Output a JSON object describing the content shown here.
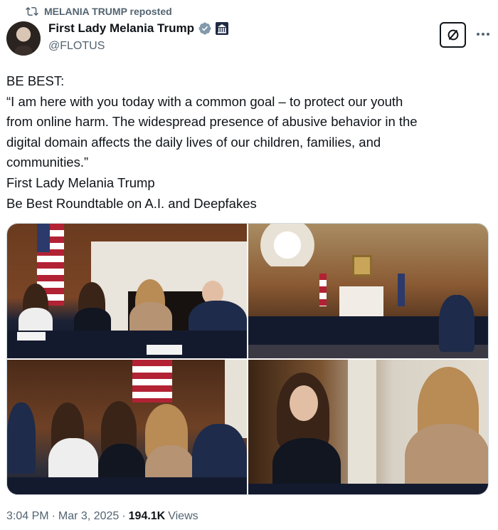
{
  "repost": {
    "text": "MELANIA TRUMP reposted"
  },
  "author": {
    "display_name": "First Lady Melania Trump",
    "handle": "@FLOTUS"
  },
  "tweet": {
    "lines": [
      "BE BEST:",
      "“I am here with you today with a common goal – to protect our youth",
      "from online harm. The widespread presence of abusive behavior in the",
      "digital domain affects the daily lives of our children, families, and",
      "communities.”",
      "First Lady Melania Trump",
      "Be Best Roundtable on A.I. and Deepfakes"
    ]
  },
  "meta": {
    "time": "3:04 PM",
    "sep1": "·",
    "date": "Mar 3, 2025",
    "sep2": "·",
    "views_count": "194.1K",
    "views_label": "Views"
  },
  "colors": {
    "text": "#0f1419",
    "secondary": "#536471",
    "verified": "#829aab",
    "border": "#cfd9de"
  },
  "icons": {
    "repost": "repost-icon",
    "verified": "verified-badge-icon",
    "government": "government-badge-icon",
    "grok": "grok-icon",
    "more": "more-icon"
  }
}
